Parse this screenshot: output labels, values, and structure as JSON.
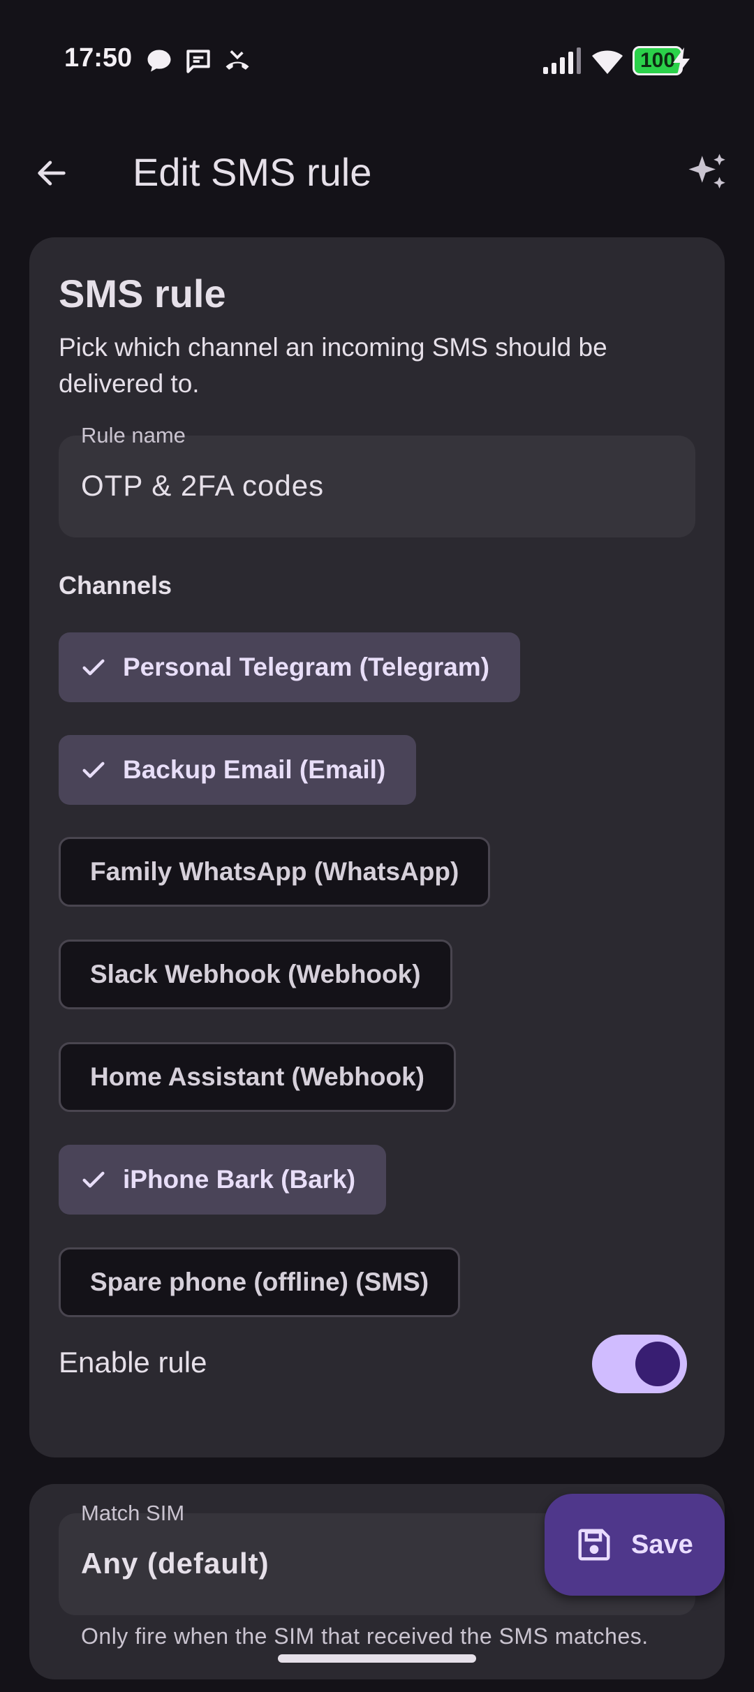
{
  "status_bar": {
    "time": "17:50",
    "battery": "100",
    "icons_left": [
      "chat-bubble-icon",
      "message-icon",
      "missed-call-icon"
    ],
    "icons_right": [
      "signal-icon",
      "wifi-icon",
      "battery-icon",
      "charging-icon"
    ]
  },
  "app_bar": {
    "title": "Edit SMS rule",
    "back_icon": "arrow-back-icon",
    "action_icon": "sparkle-icon"
  },
  "card": {
    "title": "SMS rule",
    "description": "Pick which channel an incoming SMS should be delivered to.",
    "rule_name": {
      "label": "Rule name",
      "value": "OTP & 2FA codes"
    },
    "channels_label": "Channels",
    "channels": [
      {
        "label": "Personal Telegram (Telegram)",
        "selected": true
      },
      {
        "label": "Backup Email (Email)",
        "selected": true
      },
      {
        "label": "Family WhatsApp (WhatsApp)",
        "selected": false
      },
      {
        "label": "Slack Webhook (Webhook)",
        "selected": false
      },
      {
        "label": "Home Assistant (Webhook)",
        "selected": false
      },
      {
        "label": "iPhone Bark (Bark)",
        "selected": true
      },
      {
        "label": "Spare phone (offline) (SMS)",
        "selected": false
      }
    ],
    "enable_rule": {
      "label": "Enable rule",
      "on": true
    }
  },
  "sim_card": {
    "match_sim": {
      "label": "Match SIM",
      "value": "Any (default)"
    },
    "helper": "Only fire when the SIM that received the SMS matches."
  },
  "fab": {
    "label": "Save",
    "icon": "save-icon"
  },
  "colors": {
    "background": "#141218",
    "surface": "#2b2930",
    "chip_selected": "#4a4458",
    "toggle_track": "#d0bcff",
    "fab": "#4f378b",
    "battery_green": "#2bd14a"
  }
}
